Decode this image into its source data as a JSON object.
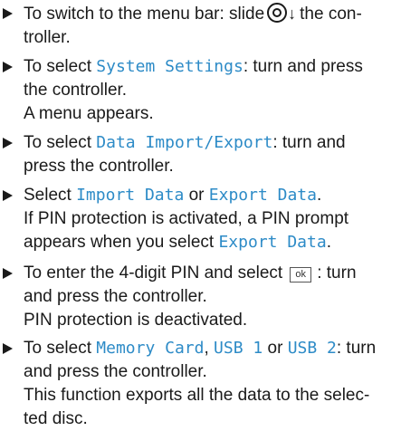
{
  "steps": [
    {
      "l1_text": "To switch to the menu bar: slide",
      "l1_tail": "the con-",
      "l2": "troller."
    },
    {
      "l1_pre": "To select ",
      "l1_hl": "System Settings",
      "l1_post": ": turn and press",
      "l2": "the controller.",
      "l3": "A menu appears."
    },
    {
      "l1_pre": "To select ",
      "l1_hl": "Data Import/Export",
      "l1_post": ": turn and",
      "l2": "press the controller."
    },
    {
      "l1_pre": "Select ",
      "l1_hl1": "Import Data",
      "l1_mid": " or ",
      "l1_hl2": "Export Data",
      "l1_post": ".",
      "l2": "If PIN protection is activated, a PIN prompt",
      "l3_pre": "appears when you select ",
      "l3_hl": "Export Data",
      "l3_post": "."
    },
    {
      "l1_pre": "To enter the 4-digit PIN and select",
      "ok_label": "ok",
      "l1_post": ": turn",
      "l2": "and press the controller.",
      "l3": "PIN protection is deactivated."
    },
    {
      "l1_pre": "To select ",
      "l1_hl1": "Memory Card",
      "l1_mid1": ", ",
      "l1_hl2": "USB 1",
      "l1_mid2": " or ",
      "l1_hl3": "USB 2",
      "l1_post": ": turn",
      "l2": "and press the controller.",
      "l3": "This function exports all the data to the selec-",
      "l4": "ted disc."
    }
  ],
  "icons": {
    "controller": "controller-icon",
    "slide_direction": "arrow-down-icon",
    "ok_key": "ok-key-icon"
  },
  "colors": {
    "highlight": "#2d8bc7",
    "text": "#1a1a1a"
  }
}
